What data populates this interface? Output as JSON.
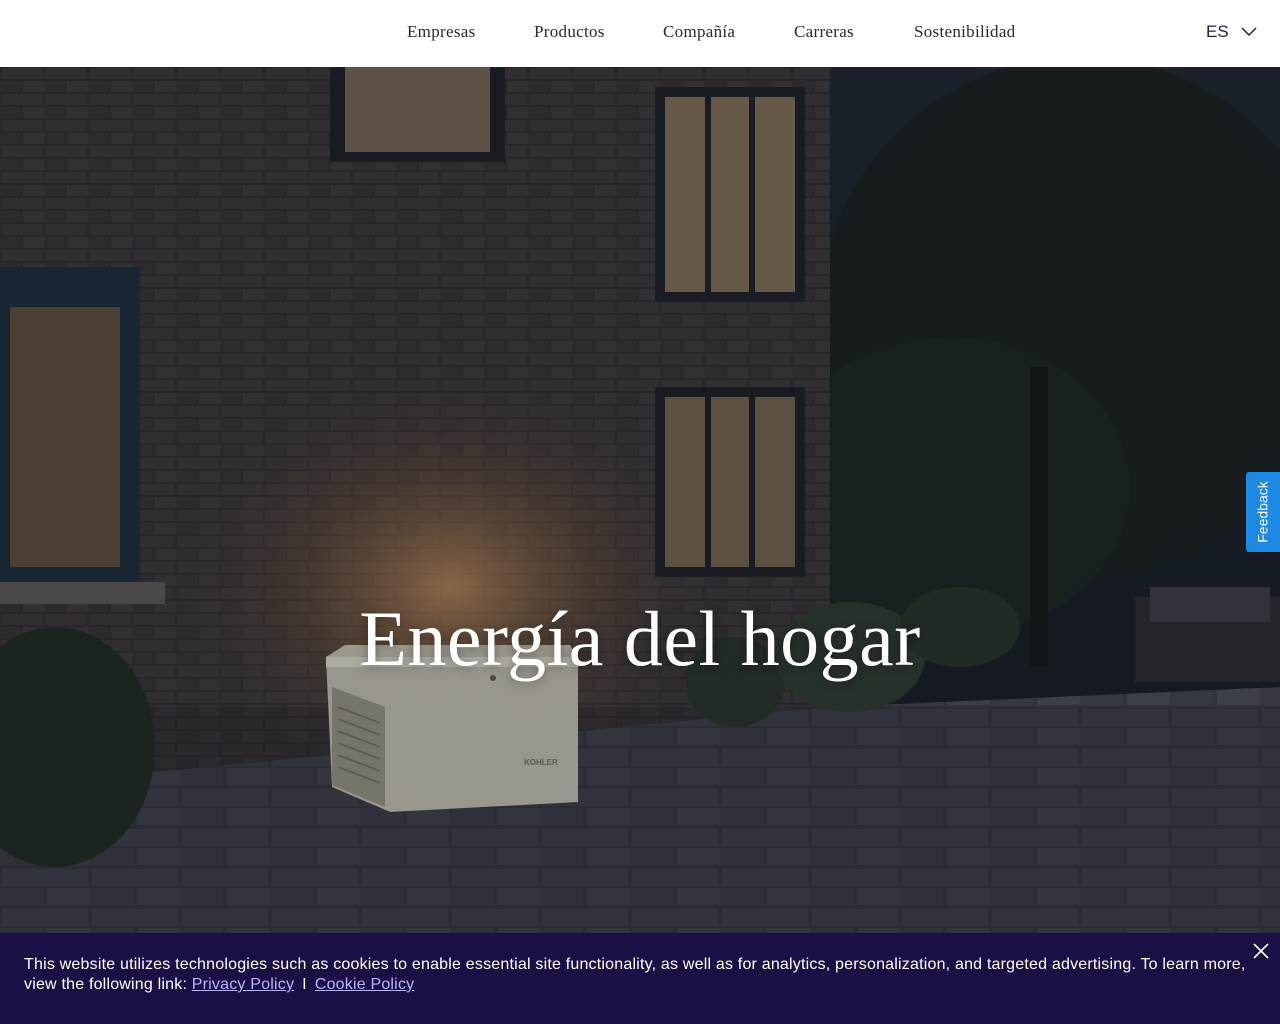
{
  "header": {
    "nav": [
      "Empresas",
      "Productos",
      "Compañía",
      "Carreras",
      "Sostenibilidad"
    ],
    "language": "ES"
  },
  "hero": {
    "title": "Energía del hogar",
    "generator_brand": "KOHLER"
  },
  "feedback": {
    "label": "Feedback"
  },
  "cookie": {
    "text": "This website utilizes technologies such as cookies to enable essential site functionality, as well as for analytics, personalization, and targeted advertising. To learn more, view the following link:",
    "privacy_link": "Privacy Policy",
    "separator": "I",
    "cookie_link": "Cookie Policy"
  },
  "colors": {
    "cookie_bg": "#1b0f45",
    "feedback_bg": "#1e88e5",
    "link": "#b9b3ff"
  }
}
